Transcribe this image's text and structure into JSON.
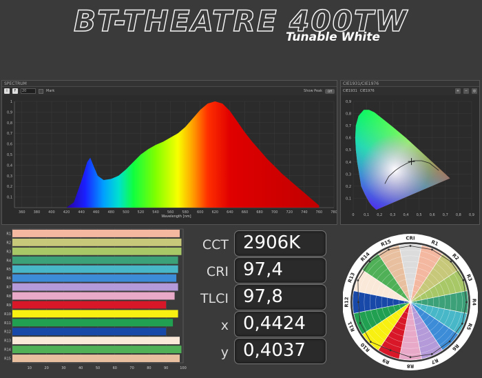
{
  "header": {
    "title": "BT-THEATRE 400TW",
    "subtitle": "Tunable White"
  },
  "spectrum": {
    "panel_title": "SPECTRUM",
    "toolbar": {
      "btn1": "I",
      "btn2": "F",
      "value": "20",
      "mark_label": "Mark",
      "show_peak_label": "Show Peak",
      "toggle": "Off"
    },
    "x_label": "Wavelength [nm]",
    "x_ticks": [
      "360",
      "380",
      "400",
      "420",
      "440",
      "460",
      "480",
      "500",
      "520",
      "540",
      "560",
      "580",
      "600",
      "620",
      "640",
      "660",
      "680",
      "700",
      "720",
      "740",
      "760",
      "780"
    ],
    "y_ticks": [
      "0,1",
      "0,2",
      "0,3",
      "0,4",
      "0,5",
      "0,6",
      "0,7",
      "0,8",
      "0,9",
      "1"
    ]
  },
  "cie": {
    "panel_title": "CIE1931/CIE1976",
    "tabs": [
      "CIE1931",
      "CIE1976"
    ],
    "x_ticks": [
      "0",
      "0,1",
      "0,2",
      "0,3",
      "0,4",
      "0,5",
      "0,6",
      "0,7",
      "0,8",
      "0,9"
    ],
    "y_ticks": [
      "0,1",
      "0,2",
      "0,3",
      "0,4",
      "0,5",
      "0,6",
      "0,7",
      "0,8",
      "0,9"
    ]
  },
  "metrics": [
    {
      "label": "CCT",
      "value": "2906K"
    },
    {
      "label": "CRI",
      "value": "97,4"
    },
    {
      "label": "TLCI",
      "value": "97,8"
    },
    {
      "label": "x",
      "value": "0,4424"
    },
    {
      "label": "y",
      "value": "0,4037"
    }
  ],
  "chart_data": [
    {
      "type": "area",
      "title": "",
      "xlabel": "Wavelength [nm]",
      "ylabel": "",
      "xlim": [
        350,
        780
      ],
      "ylim": [
        0,
        1
      ],
      "x": [
        420,
        430,
        440,
        448,
        452,
        456,
        462,
        470,
        480,
        490,
        500,
        510,
        520,
        530,
        540,
        550,
        560,
        570,
        580,
        590,
        600,
        610,
        620,
        630,
        640,
        650,
        660,
        670,
        680,
        690,
        700,
        710,
        720,
        730,
        740,
        750,
        760
      ],
      "values": [
        0.0,
        0.05,
        0.25,
        0.43,
        0.47,
        0.4,
        0.3,
        0.26,
        0.27,
        0.3,
        0.36,
        0.43,
        0.5,
        0.55,
        0.59,
        0.62,
        0.66,
        0.7,
        0.76,
        0.84,
        0.92,
        0.98,
        1.0,
        0.98,
        0.91,
        0.81,
        0.71,
        0.62,
        0.54,
        0.46,
        0.39,
        0.32,
        0.26,
        0.2,
        0.14,
        0.08,
        0.02
      ]
    },
    {
      "type": "bar",
      "title": "",
      "categories": [
        "R1",
        "R2",
        "R3",
        "R4",
        "R5",
        "R6",
        "R7",
        "R8",
        "R9",
        "R10",
        "R11",
        "R12",
        "R13",
        "R14",
        "R15"
      ],
      "values": [
        98,
        99,
        99,
        97,
        97,
        96,
        97,
        95,
        90,
        97,
        94,
        90,
        98,
        99,
        98
      ],
      "colors": [
        "#f4b8a0",
        "#c8c87a",
        "#a8c868",
        "#3ca078",
        "#48b8c8",
        "#3c8cd8",
        "#b49ad8",
        "#e8a8c8",
        "#d81828",
        "#f8f010",
        "#20a050",
        "#1848a8",
        "#fae8d8",
        "#50b058",
        "#e8c0a0"
      ],
      "xlim": [
        0,
        100
      ],
      "x_ticks": [
        "10",
        "20",
        "30",
        "40",
        "50",
        "60",
        "70",
        "80",
        "90",
        "100"
      ]
    },
    {
      "type": "scatter",
      "title": "",
      "x": [
        0.4424
      ],
      "y": [
        0.4037
      ],
      "xlim": [
        0,
        0.9
      ],
      "ylim": [
        0,
        0.9
      ]
    }
  ],
  "radial": {
    "labels": [
      "CRI",
      "R1",
      "R2",
      "R3",
      "R4",
      "R5",
      "R6",
      "R7",
      "R8",
      "R9",
      "R10",
      "R11",
      "R12",
      "R13",
      "R14",
      "R15"
    ],
    "values": [
      97,
      98,
      99,
      99,
      97,
      97,
      96,
      97,
      95,
      90,
      97,
      94,
      90,
      98,
      99,
      98
    ],
    "colors": [
      "#dcdcdc",
      "#f4b8a0",
      "#c8c87a",
      "#a8c868",
      "#3ca078",
      "#48b8c8",
      "#3c8cd8",
      "#b49ad8",
      "#e8a8c8",
      "#d81828",
      "#f8f010",
      "#20a050",
      "#1848a8",
      "#fae8d8",
      "#50b058",
      "#e8c0a0"
    ]
  }
}
